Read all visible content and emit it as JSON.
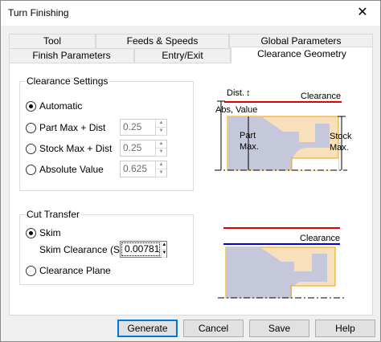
{
  "window": {
    "title": "Turn Finishing",
    "close_icon": "close-icon"
  },
  "tabs_row1": [
    {
      "label": "Tool"
    },
    {
      "label": "Feeds & Speeds"
    },
    {
      "label": "Global Parameters"
    }
  ],
  "tabs_row2": [
    {
      "label": "Finish Parameters"
    },
    {
      "label": "Entry/Exit"
    },
    {
      "label": "Clearance Geometry",
      "active": true
    }
  ],
  "clearance_settings": {
    "title": "Clearance Settings",
    "selected": "Automatic",
    "options": [
      {
        "label": "Automatic"
      },
      {
        "label": "Part Max + Dist",
        "value": "0.25"
      },
      {
        "label": "Stock Max + Dist",
        "value": "0.25"
      },
      {
        "label": "Absolute Value",
        "value": "0.625"
      }
    ]
  },
  "cut_transfer": {
    "title": "Cut Transfer",
    "selected": "Skim",
    "options": [
      {
        "label": "Skim"
      },
      {
        "label": "Clearance Plane"
      }
    ],
    "skim_label": "Skim Clearance (S)",
    "skim_value": "0.00781"
  },
  "diagram1": {
    "dist": "Dist.",
    "clearance": "Clearance",
    "abs_value": "Abs, Value",
    "part_max_1": "Part",
    "part_max_2": "Max.",
    "stock_max_1": "Stock",
    "stock_max_2": "Max."
  },
  "diagram2": {
    "clearance": "Clearance"
  },
  "colors": {
    "clearance_line": "#e00000",
    "skim_line": "#0000d0",
    "stock": "#f8e0bc",
    "stock_border": "#f5a000",
    "part": "#c4c8da"
  },
  "buttons": {
    "generate": "Generate",
    "cancel": "Cancel",
    "save": "Save",
    "help": "Help"
  }
}
